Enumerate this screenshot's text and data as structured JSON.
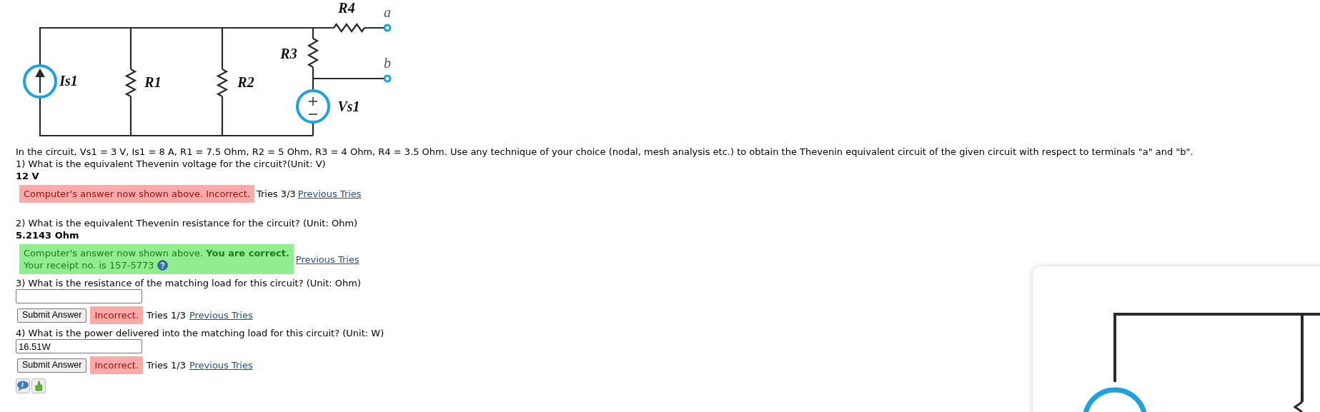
{
  "circuit": {
    "labels": [
      "R4",
      "a",
      "R3",
      "b",
      "Is1",
      "R1",
      "R2",
      "Vs1"
    ]
  },
  "problem": {
    "statement": "In the circuit, Vs1 = 3 V, Is1 = 8 A, R1 = 7.5 Ohm, R2 = 5 Ohm, R3 = 4 Ohm, R4 = 3.5 Ohm. Use any technique of your choice (nodal, mesh analysis etc.) to obtain the Thevenin equivalent circuit of the given circuit with respect to terminals \"a\" and \"b\"."
  },
  "questions": [
    {
      "kind": "answered",
      "prompt": "1) What is the equivalent Thevenin voltage for the circuit?(Unit: V)",
      "computer_answer": "12 V",
      "feedback": {
        "kind": "incorrect",
        "lines": [
          "Computer's answer now shown above. Incorrect."
        ]
      },
      "tries": "Tries 3/3",
      "link": "Previous Tries"
    },
    {
      "kind": "answered",
      "prompt": "2) What is the equivalent Thevenin resistance for the circuit? (Unit: Ohm)",
      "computer_answer": "5.2143 Ohm",
      "feedback": {
        "kind": "correct",
        "lines": [
          "Computer's answer now shown above. **You are correct.**",
          "Your receipt no. is 157-5773"
        ],
        "help": true
      },
      "link": "Previous Tries"
    },
    {
      "kind": "input",
      "prompt": "3) What is the resistance of the matching load for this circuit? (Unit: Ohm)",
      "button": "Submit Answer",
      "feedback": {
        "kind": "incorrect",
        "lines": [
          "Incorrect."
        ]
      },
      "tries": "Tries 1/3",
      "link": "Previous Tries"
    },
    {
      "kind": "input",
      "prompt": "4) What is the power delivered into the matching load for this circuit? (Unit: W)",
      "value": "16.51W",
      "button": "Submit Answer",
      "feedback": {
        "kind": "incorrect",
        "lines": [
          "Incorrect."
        ]
      },
      "tries": "Tries 1/3",
      "link": "Previous Tries"
    }
  ]
}
